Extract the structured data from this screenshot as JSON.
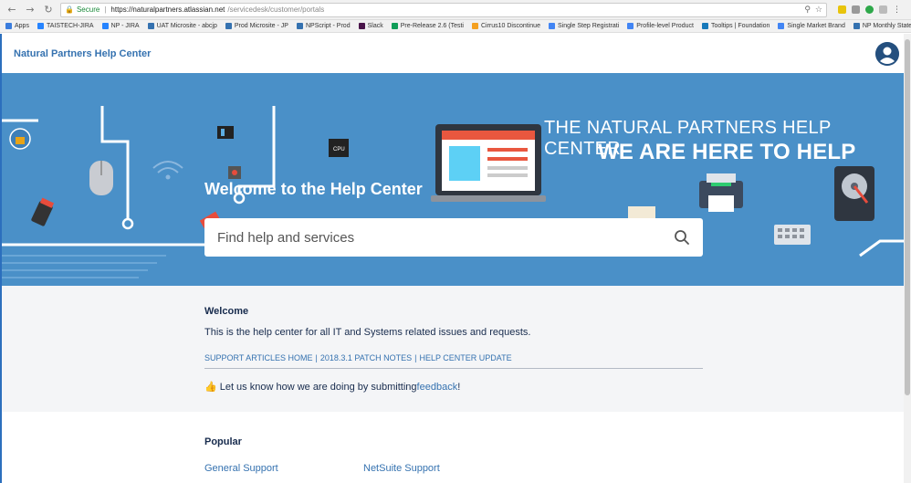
{
  "browser": {
    "secure_label": "Secure",
    "url_host": "https://naturalpartners.atlassian.net",
    "url_path": "/servicedesk/customer/portals",
    "bookmarks": [
      {
        "label": "Apps",
        "color": "#3b7ddd"
      },
      {
        "label": "TAISTECH-JIRA",
        "color": "#2684ff"
      },
      {
        "label": "NP - JIRA",
        "color": "#2684ff"
      },
      {
        "label": "UAT Microsite - abcjp",
        "color": "#3572b0"
      },
      {
        "label": "Prod Microsite - JP",
        "color": "#3572b0"
      },
      {
        "label": "NPScript - Prod",
        "color": "#3572b0"
      },
      {
        "label": "Slack",
        "color": "#4a154b"
      },
      {
        "label": "Pre-Release 2.6 (Testi",
        "color": "#0f9d58"
      },
      {
        "label": "Cirrus10 Discontinue",
        "color": "#f4a020"
      },
      {
        "label": "Single Step Registrati",
        "color": "#4285f4"
      },
      {
        "label": "Profile-level Product",
        "color": "#4285f4"
      },
      {
        "label": "Tooltips | Foundation",
        "color": "#1779ba"
      },
      {
        "label": "Single Market Brand",
        "color": "#4285f4"
      },
      {
        "label": "NP Monthly Stateme",
        "color": "#3572b0"
      }
    ],
    "more_label": "»"
  },
  "header": {
    "brand": "Natural Partners Help Center"
  },
  "hero": {
    "line1": "THE NATURAL PARTNERS HELP CENTER",
    "line2": "WE ARE HERE TO HELP",
    "welcome": "Welcome to the Help Center",
    "search_placeholder": "Find help and services"
  },
  "announcement": {
    "title": "Welcome",
    "text": "This is the help center for all IT and Systems related issues and requests.",
    "links": [
      "SUPPORT ARTICLES HOME",
      "2018.3.1 PATCH NOTES",
      "HELP CENTER UPDATE"
    ],
    "feedback_prefix": "Let us know how we are doing by submitting ",
    "feedback_link": "feedback",
    "feedback_suffix": "!"
  },
  "popular": {
    "title": "Popular",
    "items": [
      "General Support",
      "NetSuite Support"
    ]
  },
  "colors": {
    "hero_bg": "#4a90c8",
    "link": "#3572b0",
    "text": "#172b4d"
  }
}
